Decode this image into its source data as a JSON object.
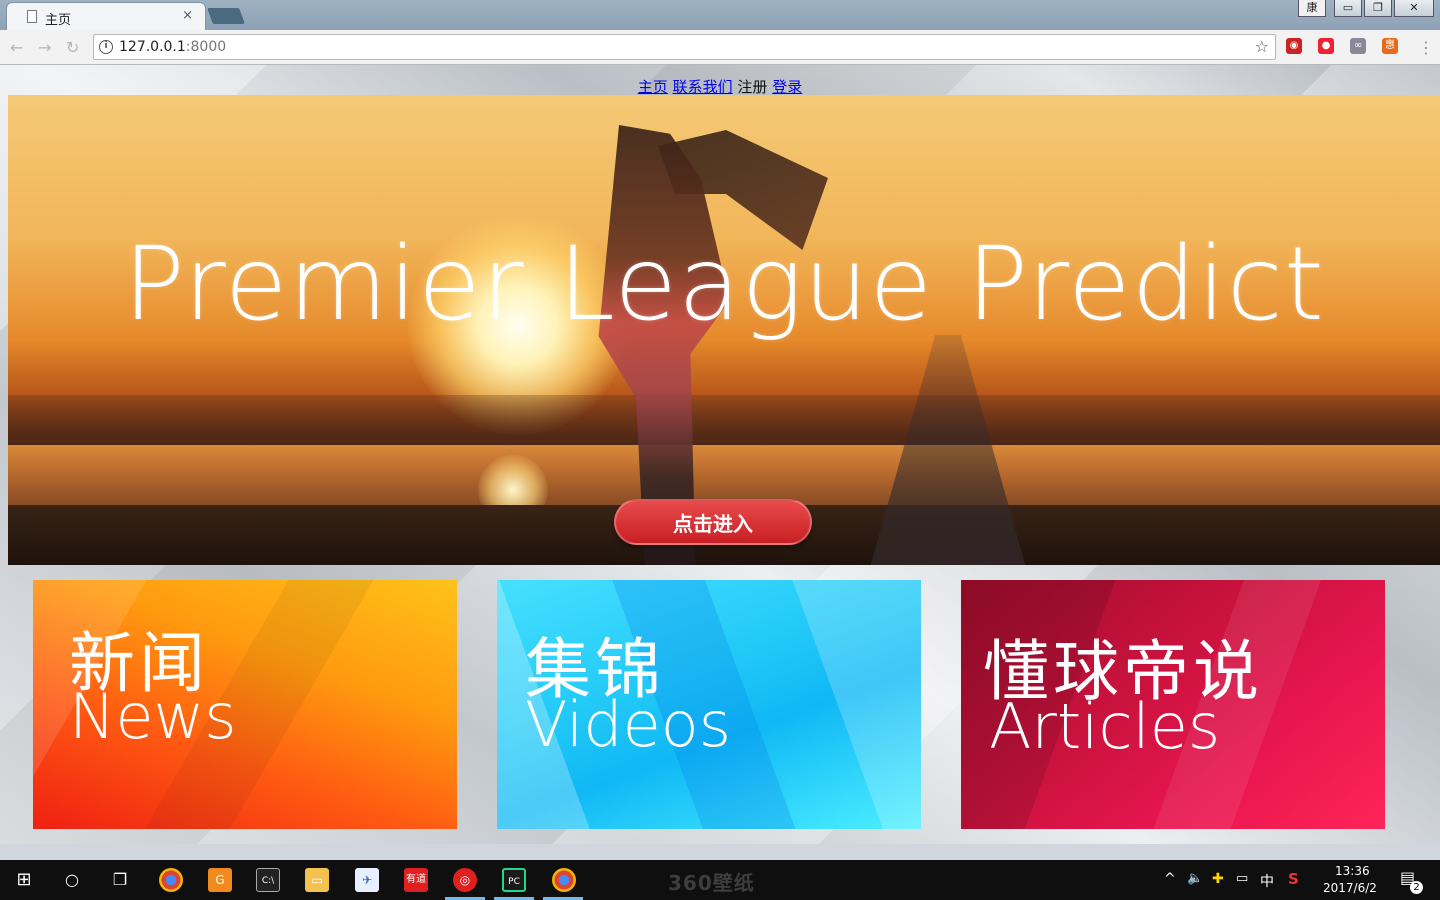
{
  "browser": {
    "tab_title": "主页",
    "tab_close": "×",
    "profile_label": "康",
    "url_host": "127.0.0.1",
    "url_port": ":8000",
    "window_controls": [
      "minimize",
      "restore",
      "close"
    ]
  },
  "nav": {
    "home": "主页",
    "contact": "联系我们",
    "register": "注册",
    "login": "登录"
  },
  "hero": {
    "title": "Premier League Predict",
    "enter_button": "点击进入"
  },
  "tiles": [
    {
      "cn": "新闻",
      "en": "News"
    },
    {
      "cn": "集锦",
      "en": "Videos"
    },
    {
      "cn": "懂球帝说",
      "en": "Articles"
    }
  ],
  "colors": {
    "news": "#ff7a12",
    "videos": "#22c9f7",
    "articles": "#d4143f",
    "enter_button": "#d9312f"
  },
  "taskbar": {
    "time": "13:36",
    "date": "2017/6/2",
    "ime": "中",
    "notification_count": "2",
    "watermark": "360壁纸"
  }
}
